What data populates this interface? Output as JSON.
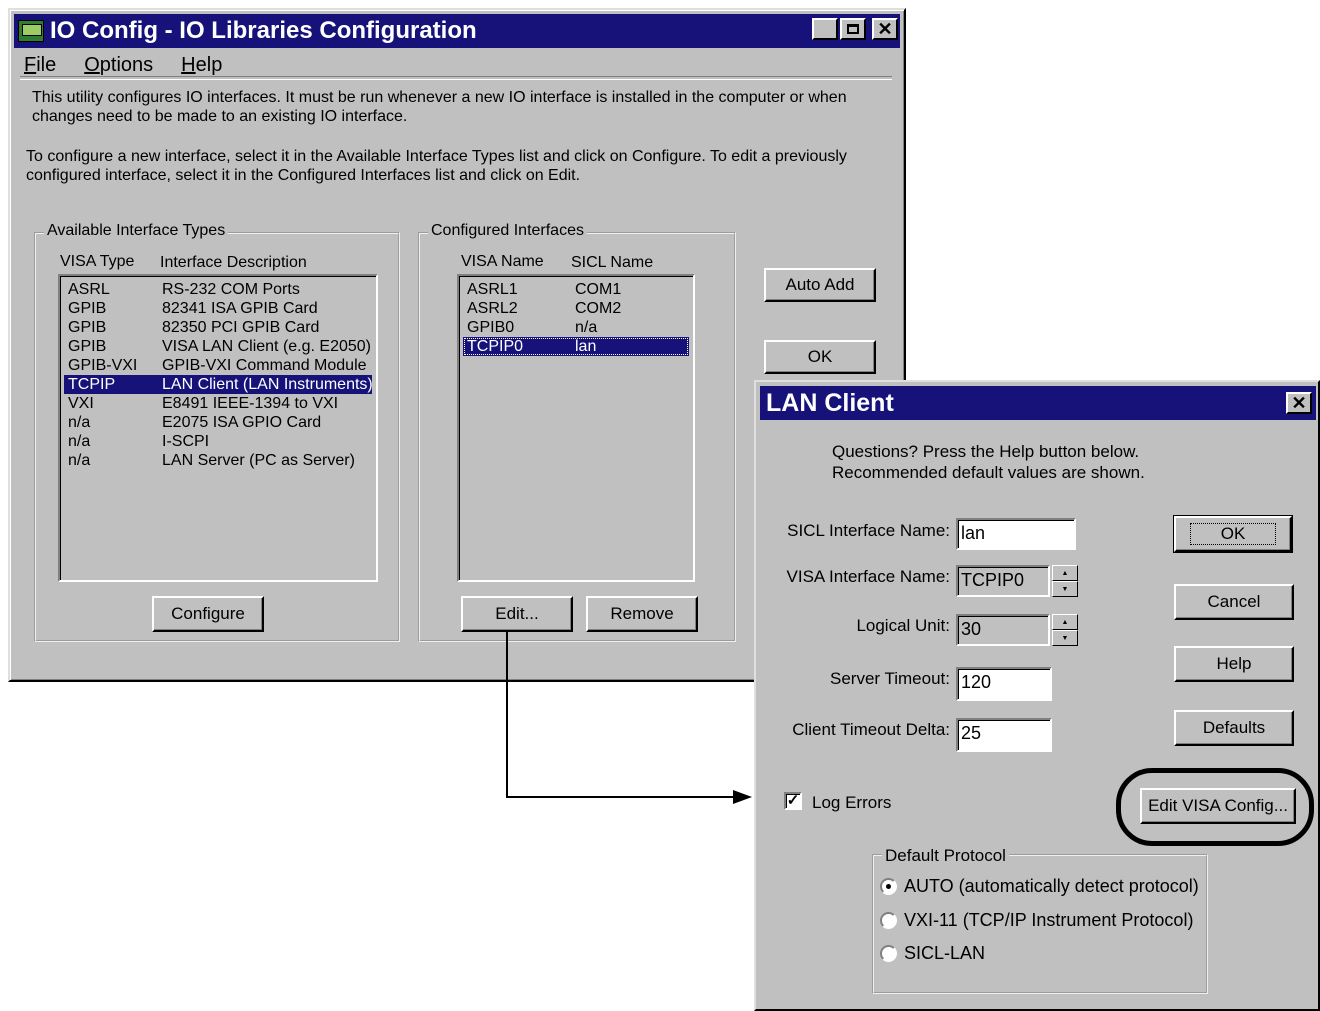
{
  "main_window": {
    "title": "IO Config - IO Libraries Configuration",
    "icon": "io-config-app-icon",
    "menu": [
      "File",
      "Options",
      "Help"
    ],
    "description1_line1": "This utility configures IO interfaces.  It must be run whenever a new IO interface is installed in the computer or when",
    "description1_line2": "changes need to be made to an existing IO interface.",
    "description2_line1": "To configure a new interface, select it in the Available Interface Types list and click on Configure.  To edit a previously",
    "description2_line2": "configured interface, select it in the Configured Interfaces list and click on Edit.",
    "available": {
      "label": "Available Interface Types",
      "col1": "VISA Type",
      "col2": "Interface Description",
      "rows": [
        {
          "type": "ASRL",
          "desc": "RS-232 COM Ports"
        },
        {
          "type": "GPIB",
          "desc": "82341 ISA GPIB Card"
        },
        {
          "type": "GPIB",
          "desc": "82350 PCI GPIB Card"
        },
        {
          "type": "GPIB",
          "desc": "VISA LAN Client (e.g. E2050)"
        },
        {
          "type": "GPIB-VXI",
          "desc": "GPIB-VXI Command Module"
        },
        {
          "type": "TCPIP",
          "desc": "LAN Client (LAN Instruments)"
        },
        {
          "type": "VXI",
          "desc": "E8491 IEEE-1394 to VXI"
        },
        {
          "type": "n/a",
          "desc": "E2075 ISA GPIO Card"
        },
        {
          "type": "n/a",
          "desc": "I-SCPI"
        },
        {
          "type": "n/a",
          "desc": "LAN Server (PC as Server)"
        }
      ],
      "selected_index": 5,
      "button": "Configure"
    },
    "configured": {
      "label": "Configured Interfaces",
      "col1": "VISA Name",
      "col2": "SICL Name",
      "rows": [
        {
          "visa": "ASRL1",
          "sicl": "COM1"
        },
        {
          "visa": "ASRL2",
          "sicl": "COM2"
        },
        {
          "visa": "GPIB0",
          "sicl": "n/a"
        },
        {
          "visa": "TCPIP0",
          "sicl": "lan"
        }
      ],
      "selected_index": 3,
      "edit_button": "Edit...",
      "remove_button": "Remove"
    },
    "auto_add_button": "Auto Add",
    "ok_button": "OK"
  },
  "lan_dialog": {
    "title": "LAN Client",
    "help_line1": "Questions?  Press the Help button below.",
    "help_line2": "Recommended default values are shown.",
    "sicl_label": "SICL Interface Name:",
    "sicl_value": "lan",
    "visa_label": "VISA Interface Name:",
    "visa_value": "TCPIP0",
    "lu_label": "Logical Unit:",
    "lu_value": "30",
    "server_timeout_label": "Server Timeout:",
    "server_timeout_value": "120",
    "client_delta_label": "Client Timeout Delta:",
    "client_delta_value": "25",
    "log_errors_label": "Log Errors",
    "log_errors_checked": true,
    "buttons": {
      "ok": "OK",
      "cancel": "Cancel",
      "help": "Help",
      "defaults": "Defaults",
      "edit_visa": "Edit VISA Config..."
    },
    "protocol": {
      "label": "Default Protocol",
      "options": [
        "AUTO (automatically detect protocol)",
        "VXI-11 (TCP/IP Instrument Protocol)",
        "SICL-LAN"
      ],
      "selected_index": 0
    }
  }
}
